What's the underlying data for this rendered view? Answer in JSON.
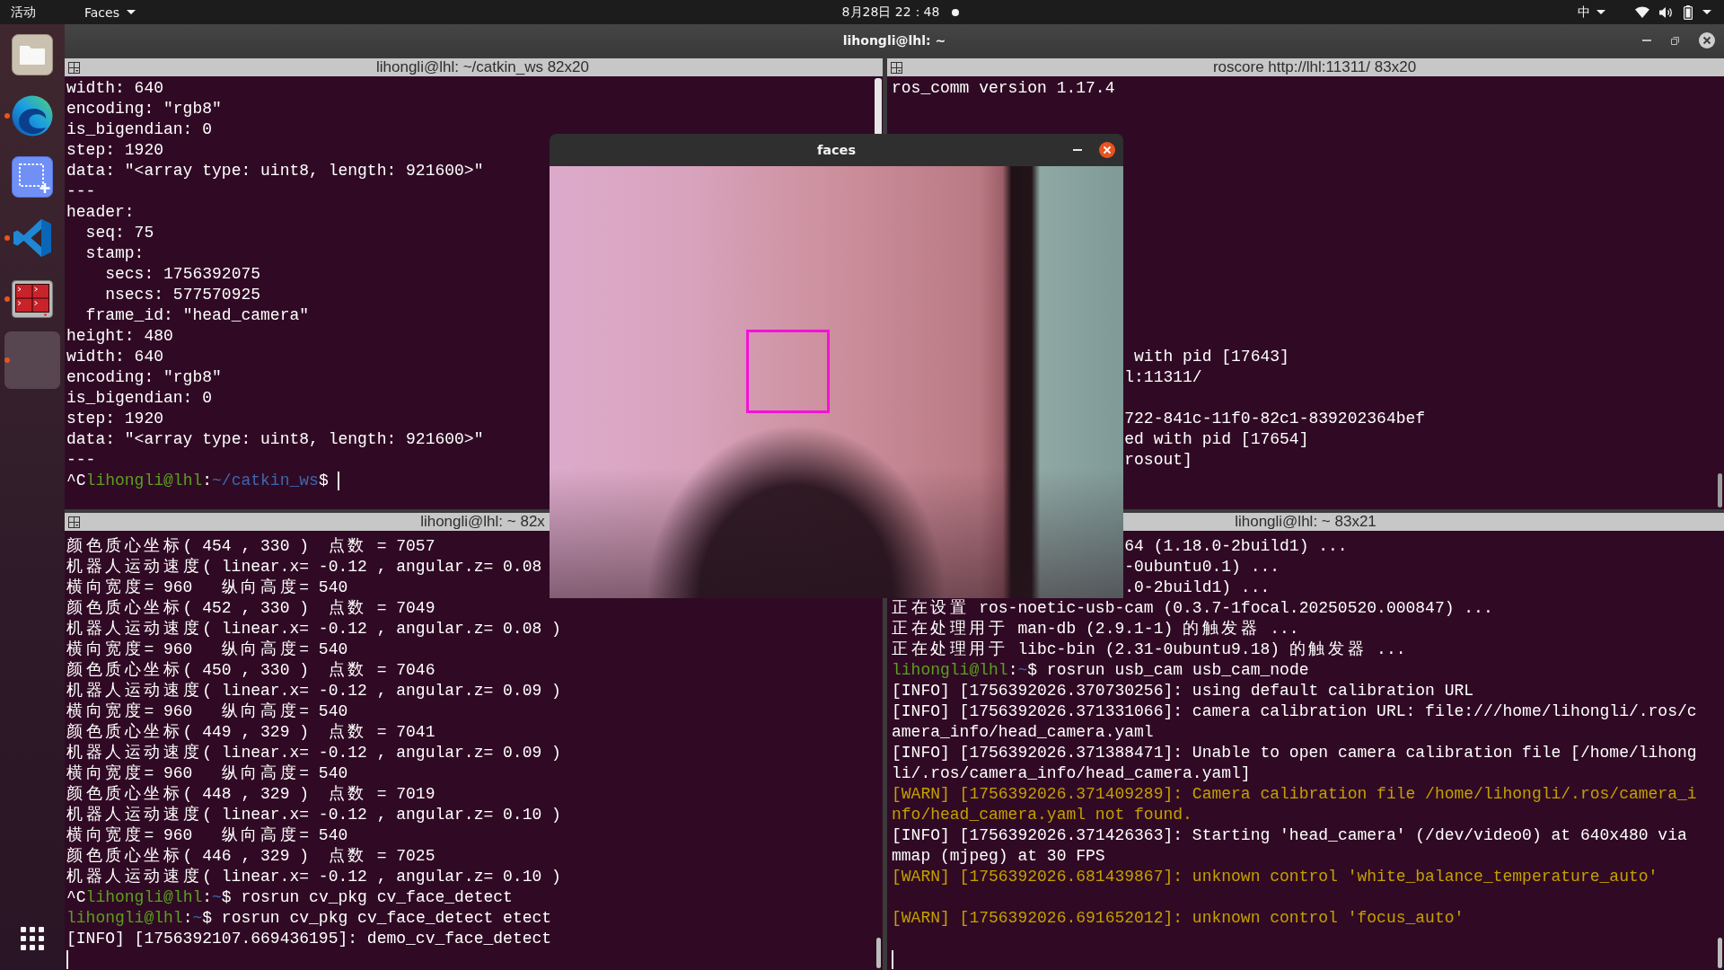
{
  "top_bar": {
    "activities": "活动",
    "app_menu": "Faces",
    "clock": "8月28日 22：48",
    "notification": true,
    "input_method": "中"
  },
  "dock": {
    "items": [
      {
        "kind": "files",
        "running": false,
        "focused": false
      },
      {
        "kind": "browser",
        "running": true,
        "focused": false
      },
      {
        "kind": "screenshot",
        "running": false,
        "focused": false
      },
      {
        "kind": "code_editor",
        "running": true,
        "focused": false
      },
      {
        "kind": "terminal",
        "running": true,
        "focused": false
      },
      {
        "kind": "blank",
        "running": true,
        "focused": true
      }
    ]
  },
  "window": {
    "title": "lihongli@lhl: ~"
  },
  "panes": [
    {
      "title": "lihongli@lhl: ~/catkin_ws 82x20",
      "menu_icon": true,
      "cursor": true,
      "lines": [
        {
          "kind": "text",
          "text": "width: 640"
        },
        {
          "kind": "text",
          "text": "encoding: \"rgb8\""
        },
        {
          "kind": "text",
          "text": "is_bigendian: 0"
        },
        {
          "kind": "text",
          "text": "step: 1920"
        },
        {
          "kind": "text",
          "text": "data: \"<array type: uint8, length: 921600>\""
        },
        {
          "kind": "text",
          "text": "---"
        },
        {
          "kind": "text",
          "text": "header:"
        },
        {
          "kind": "text",
          "text": "  seq: 75"
        },
        {
          "kind": "text",
          "text": "  stamp:"
        },
        {
          "kind": "text",
          "text": "    secs: 1756392075"
        },
        {
          "kind": "text",
          "text": "    nsecs: 577570925"
        },
        {
          "kind": "text",
          "text": "  frame_id: \"head_camera\""
        },
        {
          "kind": "text",
          "text": "height: 480"
        },
        {
          "kind": "text",
          "text": "width: 640"
        },
        {
          "kind": "text",
          "text": "encoding: \"rgb8\""
        },
        {
          "kind": "text",
          "text": "is_bigendian: 0"
        },
        {
          "kind": "text",
          "text": "step: 1920"
        },
        {
          "kind": "text",
          "text": "data: \"<array type: uint8, length: 921600>\""
        },
        {
          "kind": "text",
          "text": "---"
        },
        {
          "kind": "prompt",
          "parts": [
            {
              "kind": "plain",
              "text": "^C"
            },
            {
              "kind": "user",
              "text": "lihongli@lhl"
            },
            {
              "kind": "plain",
              "text": ":"
            },
            {
              "kind": "path",
              "text": "~/catkin_ws"
            },
            {
              "kind": "plain",
              "text": "$"
            }
          ]
        }
      ]
    },
    {
      "title": "roscore http://lhl:11311/ 83x20",
      "menu_icon": true,
      "cursor": false,
      "lines": [
        {
          "kind": "text",
          "text": "ros_comm version 1.17.4"
        },
        {
          "kind": "blank"
        },
        {
          "kind": "blank"
        },
        {
          "kind": "blank"
        },
        {
          "kind": "blank"
        },
        {
          "kind": "blank"
        },
        {
          "kind": "blank"
        },
        {
          "kind": "blank"
        },
        {
          "kind": "blank"
        },
        {
          "kind": "blank"
        },
        {
          "kind": "blank"
        },
        {
          "kind": "blank"
        },
        {
          "kind": "blank"
        },
        {
          "kind": "covered",
          "text": " with pid [17643]"
        },
        {
          "kind": "covered",
          "text": "l:11311/"
        },
        {
          "kind": "blank"
        },
        {
          "kind": "covered",
          "text": "722-841c-11f0-82c1-839202364bef"
        },
        {
          "kind": "covered",
          "text": "ed with pid [17654]"
        },
        {
          "kind": "covered",
          "text": "rosout]"
        }
      ]
    },
    {
      "title": "lihongli@lhl: ~ 82x",
      "menu_icon": true,
      "cursor": true,
      "lines": [
        {
          "kind": "text",
          "text": "颜色质心坐标( 454 , 330 )  点数 = 7057"
        },
        {
          "kind": "text",
          "text": "机器人运动速度( linear.x= -0.12 , angular.z= 0.08"
        },
        {
          "kind": "text",
          "text": "横向宽度= 960   纵向高度= 540"
        },
        {
          "kind": "text",
          "text": "颜色质心坐标( 452 , 330 )  点数 = 7049"
        },
        {
          "kind": "text",
          "text": "机器人运动速度( linear.x= -0.12 , angular.z= 0.08 )"
        },
        {
          "kind": "text",
          "text": "横向宽度= 960   纵向高度= 540"
        },
        {
          "kind": "text",
          "text": "颜色质心坐标( 450 , 330 )  点数 = 7046"
        },
        {
          "kind": "text",
          "text": "机器人运动速度( linear.x= -0.12 , angular.z= 0.09 )"
        },
        {
          "kind": "text",
          "text": "横向宽度= 960   纵向高度= 540"
        },
        {
          "kind": "text",
          "text": "颜色质心坐标( 449 , 329 )  点数 = 7041"
        },
        {
          "kind": "text",
          "text": "机器人运动速度( linear.x= -0.12 , angular.z= 0.09 )"
        },
        {
          "kind": "text",
          "text": "横向宽度= 960   纵向高度= 540"
        },
        {
          "kind": "text",
          "text": "颜色质心坐标( 448 , 329 )  点数 = 7019"
        },
        {
          "kind": "text",
          "text": "机器人运动速度( linear.x= -0.12 , angular.z= 0.10 )"
        },
        {
          "kind": "text",
          "text": "横向宽度= 960   纵向高度= 540"
        },
        {
          "kind": "text",
          "text": "颜色质心坐标( 446 , 329 )  点数 = 7025"
        },
        {
          "kind": "text",
          "text": "机器人运动速度( linear.x= -0.12 , angular.z= 0.10 )"
        },
        {
          "kind": "prompt",
          "parts": [
            {
              "kind": "plain",
              "text": "^C"
            },
            {
              "kind": "user",
              "text": "lihongli@lhl"
            },
            {
              "kind": "plain",
              "text": ":"
            },
            {
              "kind": "path",
              "text": "~"
            },
            {
              "kind": "plain",
              "text": "$ rosrun cv_pkg cv_face_detect"
            }
          ]
        },
        {
          "kind": "prompt",
          "parts": [
            {
              "kind": "user",
              "text": "lihongli@lhl"
            },
            {
              "kind": "plain",
              "text": ":"
            },
            {
              "kind": "path",
              "text": "~"
            },
            {
              "kind": "plain",
              "text": "$ rosrun cv_pkg cv_face_detect etect"
            }
          ]
        },
        {
          "kind": "text",
          "text": "[INFO] [1756392107.669436195]: demo_cv_face_detect"
        },
        {
          "kind": "blank"
        }
      ]
    },
    {
      "title": "lihongli@lhl: ~ 83x21",
      "menu_icon": false,
      "cursor": true,
      "lines": [
        {
          "kind": "covered",
          "text": "64 (1.18.0-2build1) ..."
        },
        {
          "kind": "covered",
          "text": "-0ubuntu0.1) ..."
        },
        {
          "kind": "covered",
          "text": ".0-2build1) ..."
        },
        {
          "kind": "text",
          "text": "正在设置 ros-noetic-usb-cam (0.3.7-1focal.20250520.000847) ..."
        },
        {
          "kind": "text",
          "text": "正在处理用于 man-db (2.9.1-1) 的触发器 ..."
        },
        {
          "kind": "text",
          "text": "正在处理用于 libc-bin (2.31-0ubuntu9.18) 的触发器 ..."
        },
        {
          "kind": "prompt",
          "parts": [
            {
              "kind": "user",
              "text": "lihongli@lhl"
            },
            {
              "kind": "plain",
              "text": ":"
            },
            {
              "kind": "path",
              "text": "~"
            },
            {
              "kind": "plain",
              "text": "$ rosrun usb_cam usb_cam_node"
            }
          ]
        },
        {
          "kind": "text",
          "text": "[INFO] [1756392026.370730256]: using default calibration URL"
        },
        {
          "kind": "text",
          "text": "[INFO] [1756392026.371331066]: camera calibration URL: file:///home/lihongli/.ros/c"
        },
        {
          "kind": "text",
          "text": "amera_info/head_camera.yaml"
        },
        {
          "kind": "text",
          "text": "[INFO] [1756392026.371388471]: Unable to open camera calibration file [/home/lihong"
        },
        {
          "kind": "text",
          "text": "li/.ros/camera_info/head_camera.yaml]"
        },
        {
          "kind": "warning",
          "text": "[WARN] [1756392026.371409289]: Camera calibration file /home/lihongli/.ros/camera_i"
        },
        {
          "kind": "warning",
          "text": "nfo/head_camera.yaml not found."
        },
        {
          "kind": "text",
          "text": "[INFO] [1756392026.371426363]: Starting 'head_camera' (/dev/video0) at 640x480 via"
        },
        {
          "kind": "text",
          "text": "mmap (mjpeg) at 30 FPS"
        },
        {
          "kind": "warning",
          "text": "[WARN] [1756392026.681439867]: unknown control 'white_balance_temperature_auto'"
        },
        {
          "kind": "blank"
        },
        {
          "kind": "warning",
          "text": "[WARN] [1756392026.691652012]: unknown control 'focus_auto'"
        },
        {
          "kind": "blank"
        },
        {
          "kind": "blank"
        }
      ]
    }
  ],
  "faces_window": {
    "title": "faces"
  }
}
